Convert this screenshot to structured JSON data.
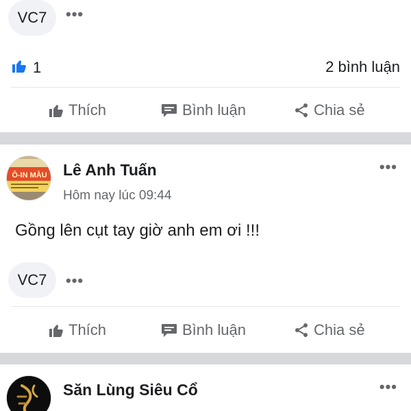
{
  "post_top": {
    "tag_chip": "VC7",
    "like_count": "1",
    "comment_count": "2 bình luận"
  },
  "actions": {
    "like": "Thích",
    "comment": "Bình luận",
    "share": "Chia sẻ"
  },
  "post_1": {
    "author": "Lê Anh Tuấn",
    "time": "Hôm nay lúc 09:44",
    "text": "Gồng lên cụt tay giờ anh em ơi !!!",
    "tag_chip": "VC7",
    "avatar_sign_text": "Ô-IN MÀU"
  },
  "post_2": {
    "author": "Săn Lùng Siêu Cổ"
  },
  "colors": {
    "like_blue": "#1877f2",
    "action_gray": "#65676b",
    "separator": "#d6d8dc",
    "chip_bg": "#f0f2f5"
  }
}
